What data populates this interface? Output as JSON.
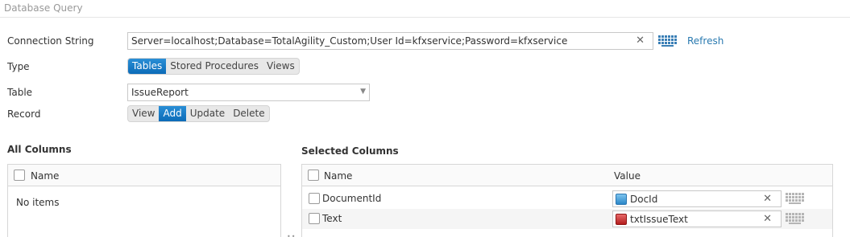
{
  "header": {
    "title": "Database Query"
  },
  "connection": {
    "label": "Connection String",
    "value": "Server=localhost;Database=TotalAgility_Custom;User Id=kfxservice;Password=kfxservice",
    "clear_icon": "close-icon",
    "keyboard_icon": "keyboard-icon",
    "refresh_label": "Refresh"
  },
  "type": {
    "label": "Type",
    "options": [
      "Tables",
      "Stored Procedures",
      "Views"
    ],
    "selected": "Tables"
  },
  "table": {
    "label": "Table",
    "value": "IssueReport"
  },
  "record": {
    "label": "Record",
    "options": [
      "View",
      "Add",
      "Update",
      "Delete"
    ],
    "selected": "Add"
  },
  "all_columns": {
    "title": "All Columns",
    "header": "Name",
    "empty_text": "No items"
  },
  "selected_columns": {
    "title": "Selected Columns",
    "header_name": "Name",
    "header_value": "Value",
    "rows": [
      {
        "name": "DocumentId",
        "value": "DocId",
        "icon": "document-variable-icon"
      },
      {
        "name": "Text",
        "value": "txtIssueText",
        "icon": "text-field-variable-icon"
      }
    ]
  },
  "colors": {
    "accent": "#1380c9",
    "link": "#2a7ab0",
    "keyboard": "#3a7fb6"
  }
}
